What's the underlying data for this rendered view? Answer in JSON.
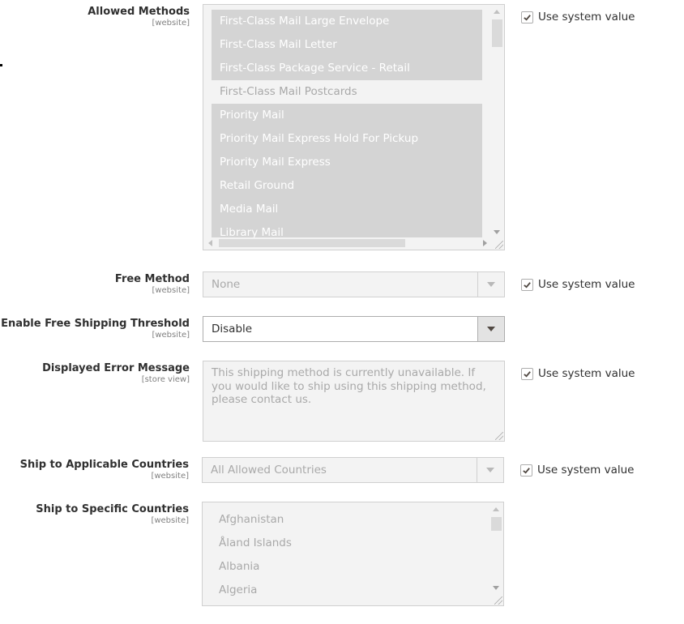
{
  "use_system_label": "Use system value",
  "fields": {
    "allowed_methods": {
      "label": "Allowed Methods",
      "scope": "[website]",
      "use_system": true,
      "options": [
        {
          "label": "First-Class Mail Large Envelope",
          "selected": true
        },
        {
          "label": "First-Class Mail Letter",
          "selected": true
        },
        {
          "label": "First-Class Package Service - Retail",
          "selected": true
        },
        {
          "label": "First-Class Mail Postcards",
          "selected": false
        },
        {
          "label": "Priority Mail",
          "selected": true
        },
        {
          "label": "Priority Mail Express Hold For Pickup",
          "selected": true
        },
        {
          "label": "Priority Mail Express",
          "selected": true
        },
        {
          "label": "Retail Ground",
          "selected": true
        },
        {
          "label": "Media Mail",
          "selected": true
        },
        {
          "label": "Library Mail",
          "selected": true
        }
      ]
    },
    "free_method": {
      "label": "Free Method",
      "scope": "[website]",
      "value": "None",
      "use_system": true
    },
    "free_shipping_threshold": {
      "label": "Enable Free Shipping Threshold",
      "scope": "[website]",
      "value": "Disable"
    },
    "error_message": {
      "label": "Displayed Error Message",
      "scope": "[store view]",
      "value": "This shipping method is currently unavailable. If you would like to ship using this shipping method, please contact us.",
      "use_system": true
    },
    "applicable_countries": {
      "label": "Ship to Applicable Countries",
      "scope": "[website]",
      "value": "All Allowed Countries",
      "use_system": true
    },
    "specific_countries": {
      "label": "Ship to Specific Countries",
      "scope": "[website]",
      "options": [
        {
          "label": "Afghanistan",
          "selected": false
        },
        {
          "label": "Åland Islands",
          "selected": false
        },
        {
          "label": "Albania",
          "selected": false
        },
        {
          "label": "Algeria",
          "selected": false
        }
      ]
    }
  }
}
